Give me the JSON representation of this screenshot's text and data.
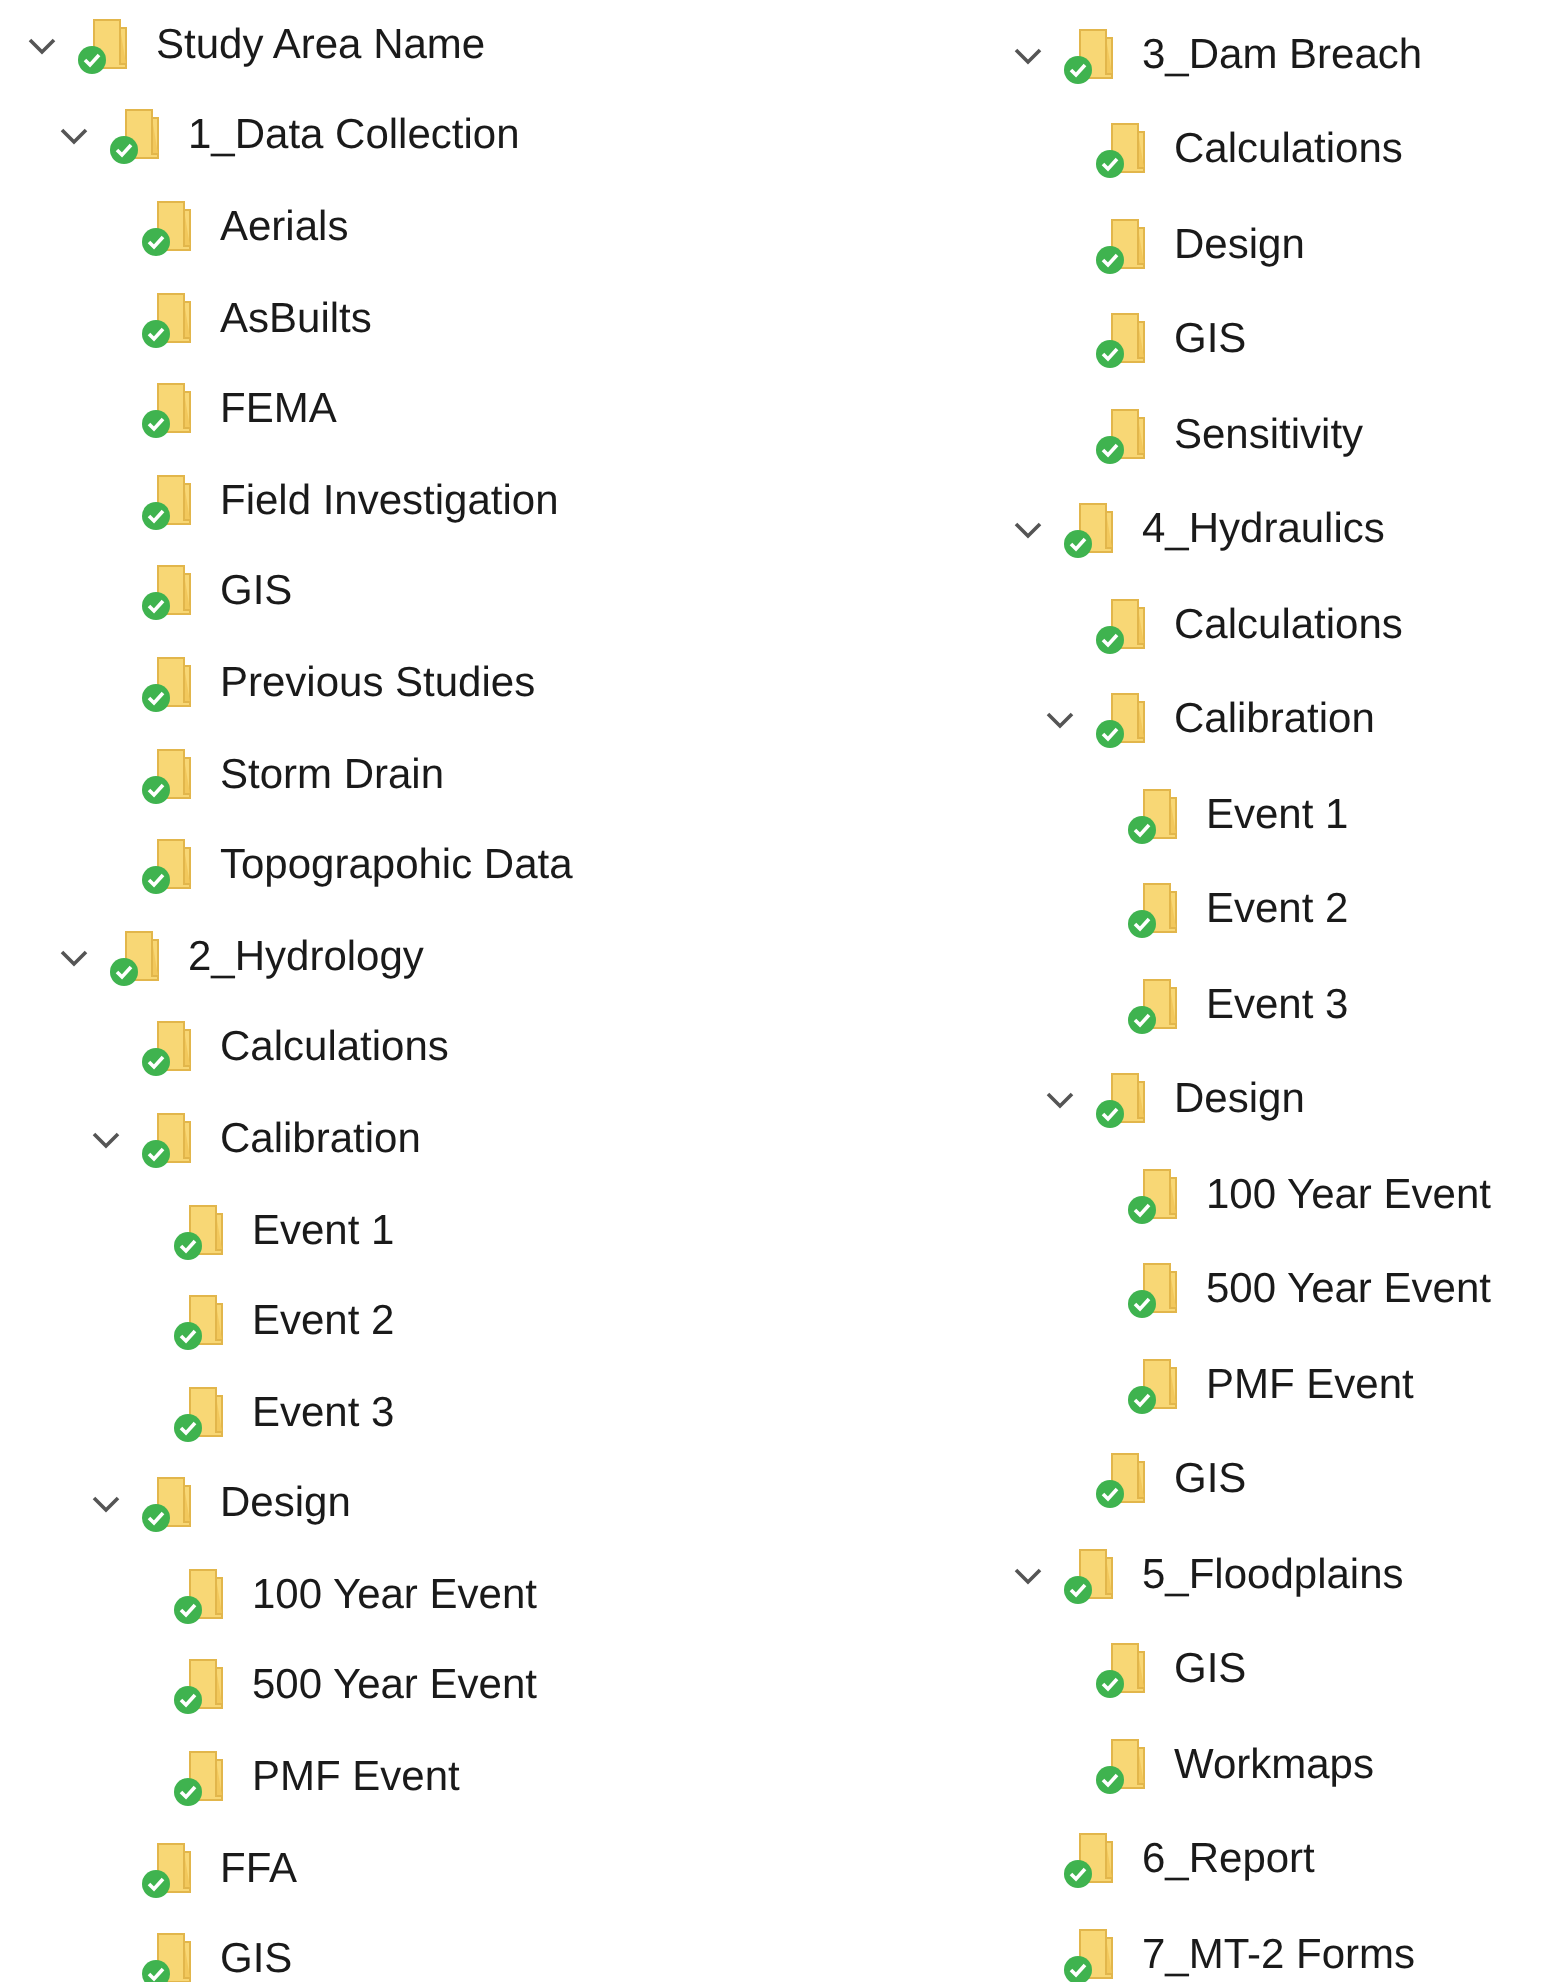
{
  "columns": [
    {
      "items": [
        {
          "label": "Study Area Name",
          "expanded": true,
          "children": [
            {
              "label": "1_Data Collection",
              "expanded": true,
              "children": [
                {
                  "label": "Aerials"
                },
                {
                  "label": "AsBuilts"
                },
                {
                  "label": "FEMA"
                },
                {
                  "label": "Field Investigation"
                },
                {
                  "label": "GIS"
                },
                {
                  "label": "Previous Studies"
                },
                {
                  "label": "Storm Drain"
                },
                {
                  "label": "Topograpohic Data"
                }
              ]
            },
            {
              "label": "2_Hydrology",
              "expanded": true,
              "children": [
                {
                  "label": "Calculations"
                },
                {
                  "label": "Calibration",
                  "expanded": true,
                  "children": [
                    {
                      "label": "Event 1"
                    },
                    {
                      "label": "Event 2"
                    },
                    {
                      "label": "Event 3"
                    }
                  ]
                },
                {
                  "label": "Design",
                  "expanded": true,
                  "children": [
                    {
                      "label": "100 Year Event"
                    },
                    {
                      "label": "500 Year Event"
                    },
                    {
                      "label": "PMF Event"
                    }
                  ]
                },
                {
                  "label": "FFA"
                },
                {
                  "label": "GIS"
                }
              ]
            }
          ]
        }
      ]
    },
    {
      "items": [
        {
          "label": "3_Dam Breach",
          "expanded": true,
          "children": [
            {
              "label": "Calculations"
            },
            {
              "label": "Design"
            },
            {
              "label": "GIS"
            },
            {
              "label": "Sensitivity"
            }
          ]
        },
        {
          "label": "4_Hydraulics",
          "expanded": true,
          "children": [
            {
              "label": "Calculations"
            },
            {
              "label": "Calibration",
              "expanded": true,
              "children": [
                {
                  "label": "Event 1"
                },
                {
                  "label": "Event 2"
                },
                {
                  "label": "Event 3"
                }
              ]
            },
            {
              "label": "Design",
              "expanded": true,
              "children": [
                {
                  "label": "100 Year Event"
                },
                {
                  "label": "500 Year Event"
                },
                {
                  "label": "PMF Event"
                }
              ]
            },
            {
              "label": "GIS"
            }
          ]
        },
        {
          "label": "5_Floodplains",
          "expanded": true,
          "children": [
            {
              "label": "GIS"
            },
            {
              "label": "Workmaps"
            }
          ]
        },
        {
          "label": "6_Report"
        },
        {
          "label": "7_MT-2 Forms"
        }
      ]
    }
  ]
}
